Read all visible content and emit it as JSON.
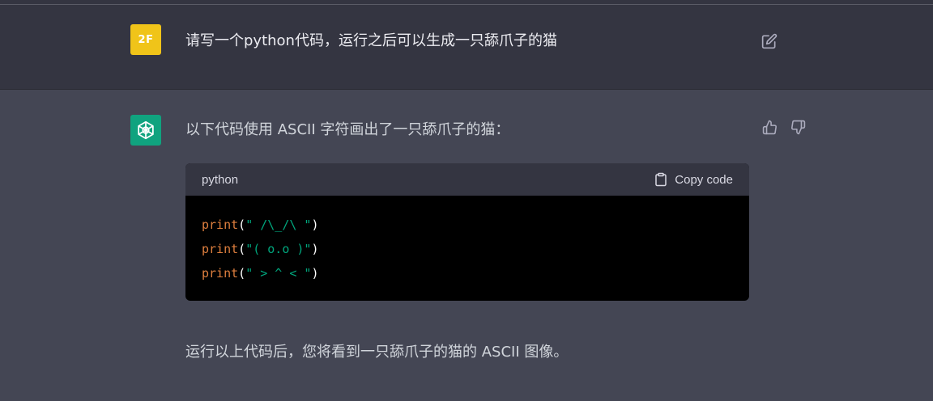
{
  "user": {
    "avatar_text": "2F",
    "message": "请写一个python代码，运行之后可以生成一只舔爪子的猫"
  },
  "bot": {
    "intro": "以下代码使用 ASCII 字符画出了一只舔爪子的猫：",
    "code_block": {
      "language": "python",
      "copy_label": "Copy code",
      "lines": [
        {
          "fn": "print",
          "open": "(",
          "str": "\" /\\_/\\ \"",
          "close": ")"
        },
        {
          "fn": "print",
          "open": "(",
          "str": "\"( o.o )\"",
          "close": ")"
        },
        {
          "fn": "print",
          "open": "(",
          "str": "\" > ^ < \"",
          "close": ")"
        }
      ]
    },
    "outro": "运行以上代码后，您将看到一只舔爪子的猫的 ASCII 图像。"
  },
  "icons": {
    "edit": "edit-icon",
    "thumbs_up": "thumbs-up-icon",
    "thumbs_down": "thumbs-down-icon",
    "copy": "clipboard-icon",
    "bot_logo": "openai-logo-icon"
  },
  "colors": {
    "user_bg": "#343541",
    "bot_bg": "#444654",
    "user_avatar": "#f0c419",
    "bot_avatar": "#10a37f",
    "code_keyword": "#df7f3e",
    "code_string": "#00a67d"
  }
}
